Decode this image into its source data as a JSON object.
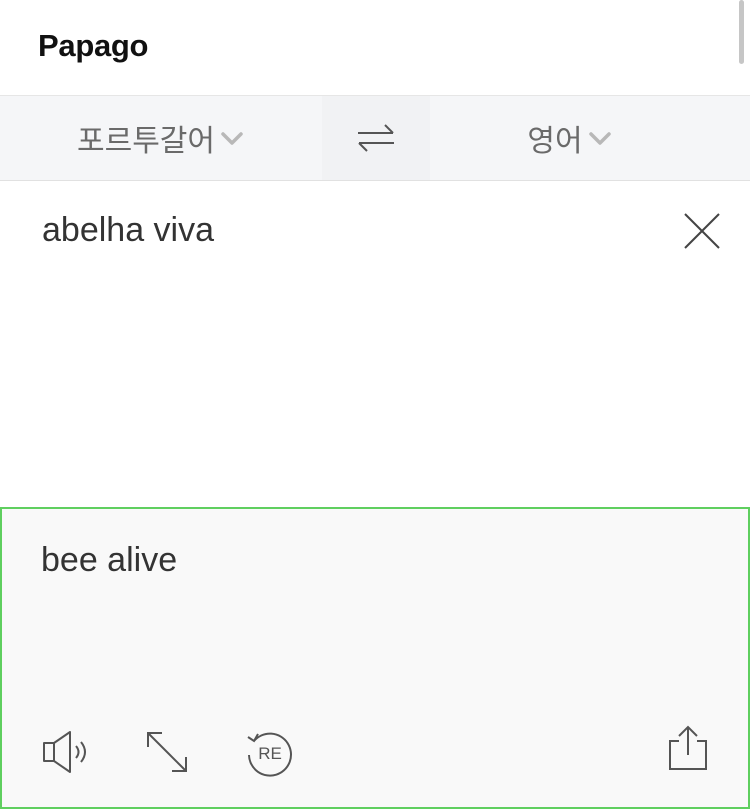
{
  "header": {
    "title": "Papago"
  },
  "language_bar": {
    "source_language": "포르투갈어",
    "target_language": "영어",
    "swap_icon": "swap-arrows-icon",
    "dropdown_icon": "chevron-down-icon"
  },
  "source": {
    "text": "abelha viva",
    "clear_icon": "close-icon"
  },
  "result": {
    "text": "bee alive",
    "tools": [
      {
        "name": "speaker-icon"
      },
      {
        "name": "expand-icon"
      },
      {
        "name": "retranslate-icon",
        "label": "RE"
      },
      {
        "name": "share-icon"
      }
    ]
  },
  "colors": {
    "result_border": "#5fcf5f",
    "language_bar_bg": "#f5f6f8",
    "text": "#333333"
  }
}
